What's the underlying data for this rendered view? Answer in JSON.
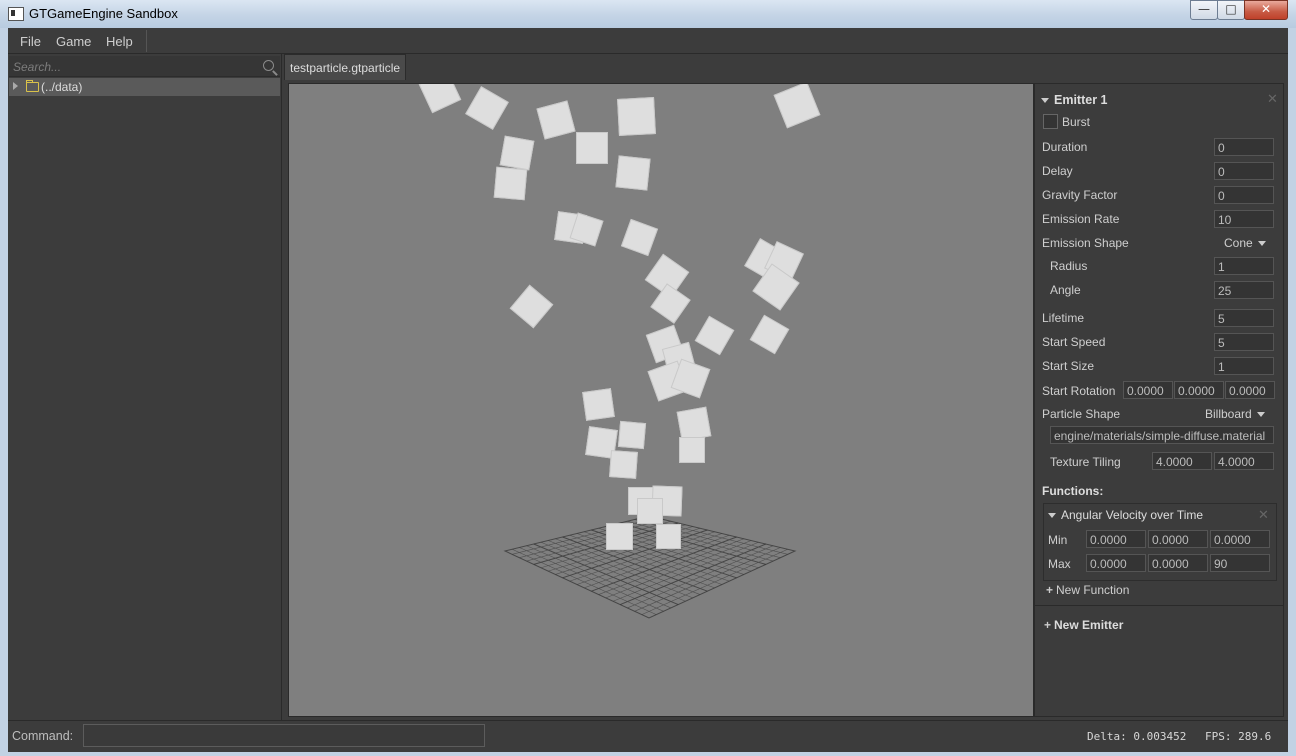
{
  "window": {
    "title": "GTGameEngine Sandbox",
    "min_label": "—",
    "max_label": "□",
    "close_label": "✕"
  },
  "menu": {
    "items": [
      "File",
      "Game",
      "Help"
    ]
  },
  "explorer": {
    "search_placeholder": "Search...",
    "tree": [
      {
        "label": "(../data)"
      }
    ]
  },
  "editor": {
    "tab_label": "testparticle.gtparticle"
  },
  "emitter": {
    "title": "Emitter 1",
    "burst_label": "Burst",
    "burst_checked": false,
    "duration_label": "Duration",
    "duration": "0",
    "delay_label": "Delay",
    "delay": "0",
    "gravity_label": "Gravity Factor",
    "gravity": "0",
    "rate_label": "Emission Rate",
    "rate": "10",
    "shape_label": "Emission Shape",
    "shape": "Cone",
    "radius_label": "Radius",
    "radius": "1",
    "angle_label": "Angle",
    "angle": "25",
    "lifetime_label": "Lifetime",
    "lifetime": "5",
    "speed_label": "Start Speed",
    "speed": "5",
    "size_label": "Start Size",
    "size": "1",
    "rotation_label": "Start Rotation",
    "rotation": [
      "0.0000",
      "0.0000",
      "0.0000"
    ],
    "particle_shape_label": "Particle Shape",
    "particle_shape": "Billboard",
    "material": "engine/materials/simple-diffuse.material",
    "tiling_label": "Texture Tiling",
    "tiling": [
      "4.0000",
      "4.0000"
    ],
    "functions_label": "Functions:",
    "function": {
      "title": "Angular Velocity over Time",
      "min_label": "Min",
      "min": [
        "0.0000",
        "0.0000",
        "0.0000"
      ],
      "max_label": "Max",
      "max": [
        "0.0000",
        "0.0000",
        "90"
      ]
    },
    "new_function": "New Function",
    "new_emitter": "New Emitter"
  },
  "status": {
    "command_label": "Command:",
    "delta": "Delta: 0.003452",
    "fps": "FPS: 289.6"
  },
  "colors": {
    "background": "#3c3c3c",
    "viewport": "#7f7f7f",
    "particle": "#dedede",
    "grid": "#333333"
  },
  "icons": [
    "app-icon",
    "search-icon",
    "folder-icon",
    "expand-arrow-icon",
    "collapse-arrow-icon",
    "close-icon",
    "dropdown-caret-icon",
    "plus-icon"
  ]
}
